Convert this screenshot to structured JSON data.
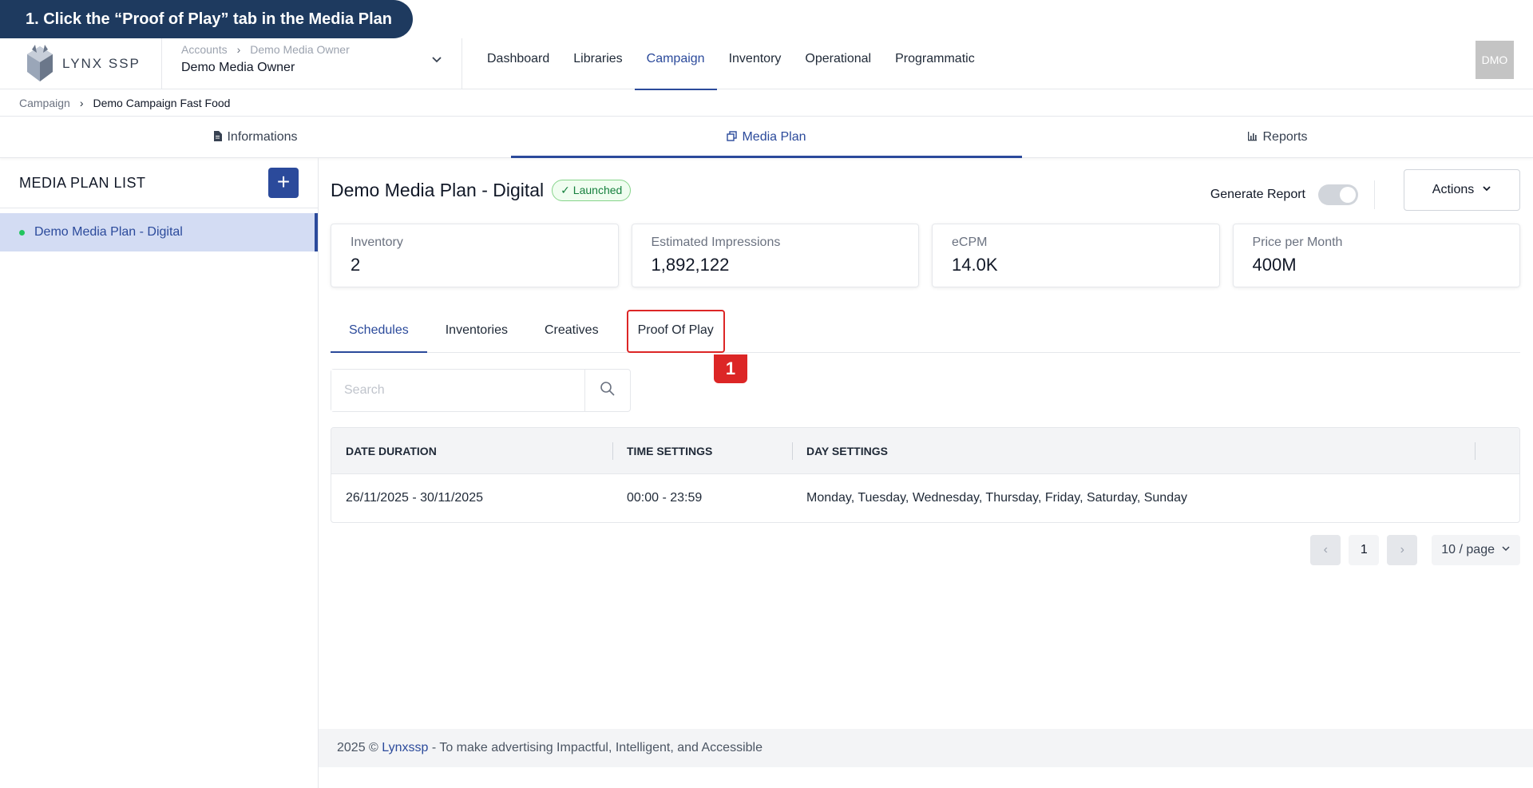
{
  "banner": {
    "text": "1. Click the “Proof of Play” tab in the Media Plan"
  },
  "header": {
    "logo_text": "LYNX SSP",
    "account_crumb": [
      "Accounts",
      "Demo Media Owner"
    ],
    "account_name": "Demo Media Owner",
    "nav": [
      "Dashboard",
      "Libraries",
      "Campaign",
      "Inventory",
      "Operational",
      "Programmatic"
    ],
    "active_nav": "Campaign",
    "avatar": "DMO"
  },
  "breadcrumb": [
    "Campaign",
    "Demo Campaign Fast Food"
  ],
  "top_tabs": [
    {
      "label": "Informations",
      "icon": "document-icon"
    },
    {
      "label": "Media Plan",
      "icon": "copy-icon"
    },
    {
      "label": "Reports",
      "icon": "bar-chart-icon"
    }
  ],
  "sidebar": {
    "title": "MEDIA PLAN LIST",
    "add_label": "+",
    "items": [
      "Demo Media Plan - Digital"
    ]
  },
  "plan": {
    "title": "Demo Media Plan - Digital",
    "status": "Launched",
    "generate_report_label": "Generate Report",
    "actions_label": "Actions"
  },
  "cards": [
    {
      "label": "Inventory",
      "value": "2"
    },
    {
      "label": "Estimated Impressions",
      "value": "1,892,122"
    },
    {
      "label": "eCPM",
      "value": "14.0K"
    },
    {
      "label": "Price per Month",
      "value": "400M"
    }
  ],
  "sub_tabs": [
    "Schedules",
    "Inventories",
    "Creatives",
    "Proof Of Play"
  ],
  "step_marker": "1",
  "search": {
    "placeholder": "Search",
    "value": ""
  },
  "table": {
    "columns": [
      "DATE DURATION",
      "TIME SETTINGS",
      "DAY SETTINGS"
    ],
    "rows": [
      [
        "26/11/2025 - 30/11/2025",
        "00:00 - 23:59",
        "Monday, Tuesday, Wednesday, Thursday, Friday, Saturday, Sunday"
      ]
    ]
  },
  "pagination": {
    "current": "1",
    "page_size": "10 / page"
  },
  "footer": {
    "prefix": "2025 © ",
    "brand": "Lynxssp",
    "suffix": " - To make advertising Impactful, Intelligent, and Accessible"
  },
  "colors": {
    "primary": "#2b4a9b",
    "highlight": "#dc2626",
    "banner": "#1e3a5f",
    "success": "#15803d"
  }
}
